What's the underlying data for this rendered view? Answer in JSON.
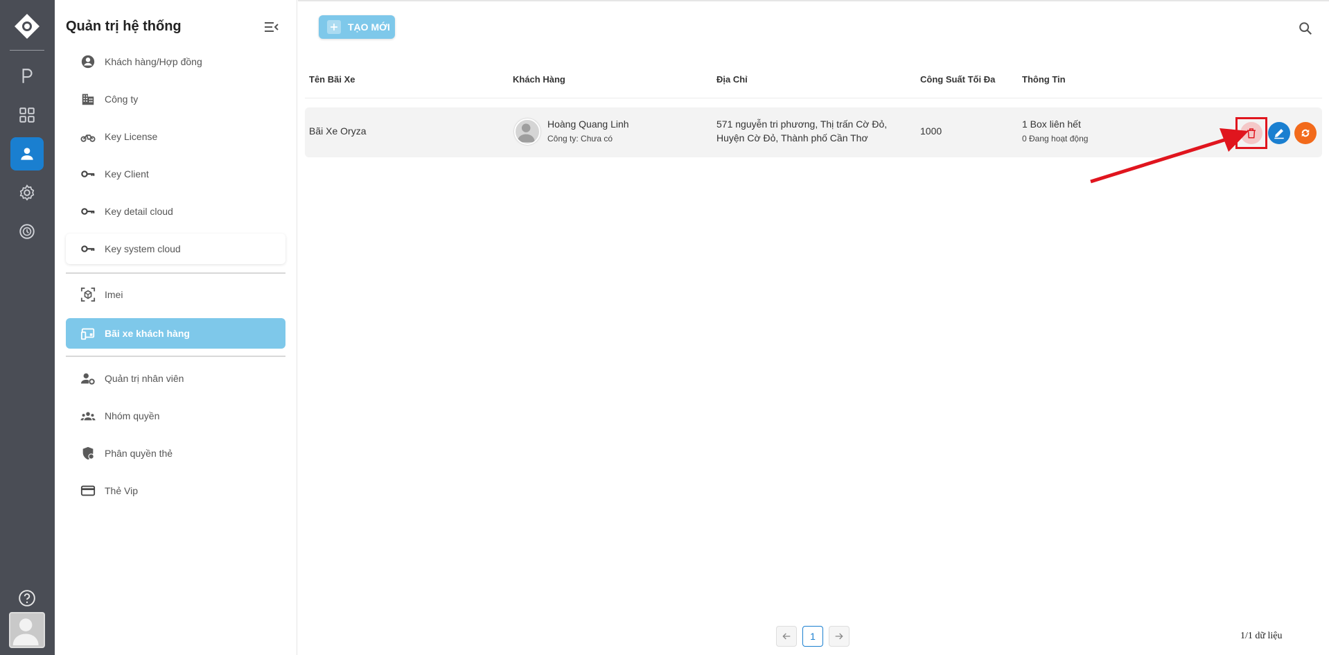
{
  "sidebar": {
    "title": "Quản trị hệ thống",
    "items": [
      {
        "label": "Khách hàng/Hợp đồng",
        "icon": "account-circle-icon"
      },
      {
        "label": "Công ty",
        "icon": "building-icon"
      },
      {
        "label": "Key License",
        "icon": "motorbike-icon"
      },
      {
        "label": "Key Client",
        "icon": "key-icon"
      },
      {
        "label": "Key detail cloud",
        "icon": "key-icon"
      },
      {
        "label": "Key system cloud",
        "icon": "key-icon"
      },
      {
        "label": "Imei",
        "icon": "scan-cube-icon"
      },
      {
        "label": "Bãi xe khách hàng",
        "icon": "devices-icon"
      },
      {
        "label": "Quản trị nhân viên",
        "icon": "user-gear-icon"
      },
      {
        "label": "Nhóm quyền",
        "icon": "group-icon"
      },
      {
        "label": "Phân quyền thẻ",
        "icon": "shield-icon"
      },
      {
        "label": "Thẻ Vip",
        "icon": "credit-card-icon"
      }
    ]
  },
  "toolbar": {
    "new_label": "TẠO MỚI"
  },
  "table": {
    "headers": [
      "Tên Bãi Xe",
      "Khách Hàng",
      "Địa Chỉ",
      "Công Suất Tối Đa",
      "Thông Tin"
    ],
    "rows": [
      {
        "name": "Bãi Xe Oryza",
        "customer_name": "Hoàng Quang Linh",
        "customer_company": "Công ty: Chưa có",
        "address_line1": "571 nguyễn tri phương, Thị trấn Cờ Đỏ,",
        "address_line2": "Huyện Cờ Đỏ, Thành phố Cần Thơ",
        "capacity": "1000",
        "info_line1": "1 Box liên hết",
        "info_line2": "0 Đang hoạt động"
      }
    ]
  },
  "pagination": {
    "current": "1",
    "summary": "1/1 dữ liệu"
  },
  "colors": {
    "primary": "#1a7fd0",
    "accent_light": "#7ec8ea",
    "delete_bg": "#f4c8c8",
    "sync": "#f26a1b",
    "highlight": "#e0151e"
  }
}
